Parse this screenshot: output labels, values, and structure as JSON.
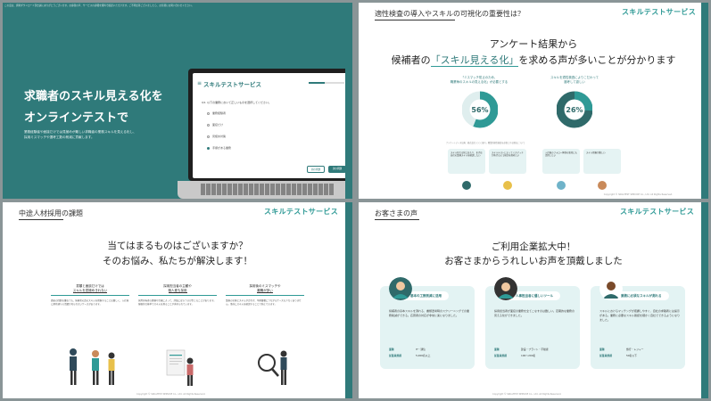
{
  "slide1": {
    "top_note": "この度は、資料ダウンロード頂き誠にありがとうございます。お客様の声、サービスの詳細を資料で確認いただけます。ご不明点等ございましたら、お気軽にお問い合わせください。",
    "heading_line1": "求職者のスキル見える化を",
    "heading_line2": "オンラインテストで",
    "desc_line1": "業務経験者や面接だけでは見極めが難しい求職者の業務スキルを見える化し、",
    "desc_line2": "採用ミスマッチや選考工数の削減に貢献します。",
    "app": {
      "title": "スキルテストサービス",
      "progress": 0.45,
      "question": "Q2. 以下の業務において正しいものを選択してください。",
      "options": [
        "業務経験者",
        "面接だけ",
        "見極め対策",
        "手順がある業務"
      ],
      "back_label": "前の問題",
      "next_label": "次の問題"
    }
  },
  "slide2": {
    "title": "適性検査の導入やスキルの可視化の重要性は？",
    "brand": "スキルテストサービス",
    "heading_line1": "アンケート結果から",
    "heading_line2_pre": "候補者の",
    "heading_line2_hl": "「スキル見える化」",
    "heading_line2_post": "を求める声が多いことが分かります",
    "donut1": {
      "label_line1": "「ミスマッチ防止のため、",
      "label_line2": "職業毎のスキルの見える化」が必要とする",
      "percent_text": "56%",
      "value": 56
    },
    "donut2": {
      "label_line1": "スキルを適性検査によりこだわって",
      "label_line2": "選考して欲しい",
      "percent_text": "26%",
      "value": 26
    },
    "note": "アンケートデータ出典：株式会社○○○○調べ。職業別適性検査を必要とする理由について",
    "quotes": [
      "スキル見える化にあたり、まずは自社の業務スキルを確認したい",
      "スキルテストによってミスマッチが防げるよう検討を進めたい",
      "入社後のフォロー体制の強化にも活用したい",
      "スキル把握が難しい"
    ],
    "colors": {
      "teal": "#2f9a96",
      "dark": "#2f6a6a",
      "light": "#dfeeee"
    }
  },
  "slide3": {
    "title": "中途人材採用の課題",
    "brand": "スキルテストサービス",
    "heading_line1": "当てはまるものはございますか？",
    "heading_line2": "そのお悩み、私たちが解決します！",
    "points": [
      {
        "title_line1": "書類と面談だけでは",
        "title_line2": "スキルを見極めきれない",
        "body": "面接の回数を重ねても、候補者の真のスキルを把握することは難しく、入社後に期待通りの活躍が見られないケースがあります。"
      },
      {
        "title_line1": "採用担当者の主観や",
        "title_line2": "個人差も採用",
        "body": "採用担当者の経験や主観によって、評価にばらつきが生じることがあります。客観的な基準でスキルを測ることが求められています。"
      },
      {
        "title_line1": "採用後のミスマッチや",
        "title_line2": "離職が多い",
        "body": "業務の実態とスキルが合わず、早期離職につながるケースも少なくありません。事前にスキルを確認することで防止できます。"
      }
    ]
  },
  "slide4": {
    "title": "お客さまの声",
    "brand": "スキルテストサービス",
    "heading_line1": "ご利用企業拡大中！",
    "heading_line2": "お客さまからうれしいお声を頂戴しました",
    "voices": [
      {
        "head": "基本の工数削減に活用",
        "body": "候補者の基本スキルを測れる、書類選考時のスクリーニングでの業務削減ができる。応募者の対応が非常に楽になりました。",
        "industry_label": "業種",
        "industry": "IT・通信",
        "size_label": "従業員規模",
        "size": "5,000名以上"
      },
      {
        "head": "人事担当者に優しいツール",
        "body": "採用担当者が面接の業務を全てこなすのは難しい。定期的な業務の見える化ができました。",
        "industry_label": "業種",
        "industry": "建設・プラント・不動産",
        "size_label": "従業員規模",
        "size": "100〜200名"
      },
      {
        "head": "業務に必須なスキルが測れる",
        "body": "スキルにおけるマッチングが把握しやすく、自社の求職者には提示がある。業務に必要なスキル確認を細かく自社でできるようになりました。",
        "industry_label": "業種",
        "industry": "旅行・レジャー",
        "size_label": "従業員規模",
        "size": "50名以下"
      }
    ]
  },
  "copyright": "Copyright © SKILLTEST SERVICE Co., Ltd. All Rights Reserved."
}
